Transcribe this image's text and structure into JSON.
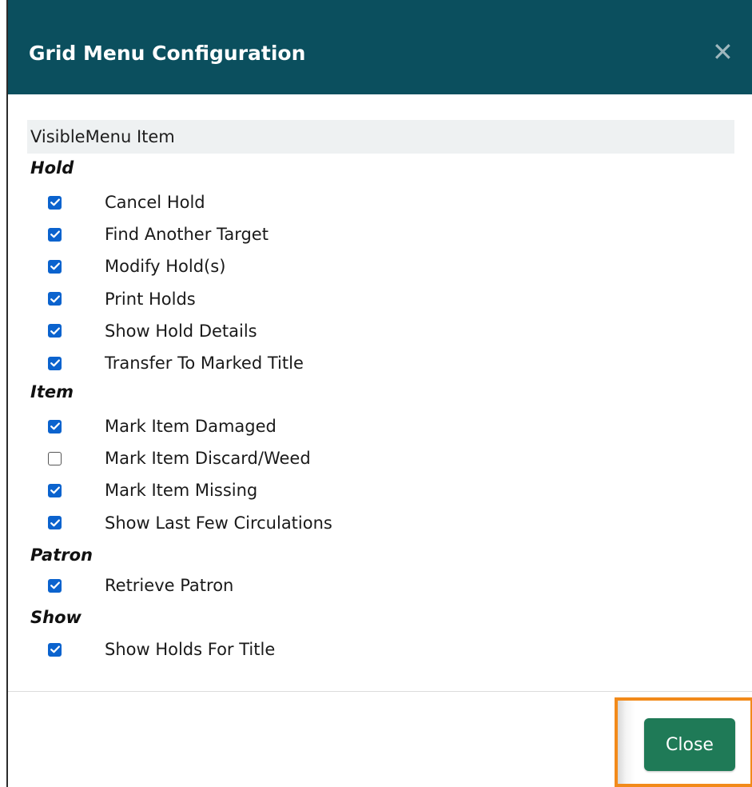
{
  "dialog": {
    "title": "Grid Menu Configuration",
    "close_icon": "close-icon",
    "close_glyph": "✕",
    "header_color": "#0b4f5e"
  },
  "grid": {
    "column_visible": "Visible",
    "column_menu_item": "Menu Item",
    "groups": [
      {
        "name": "Hold",
        "items": [
          {
            "label": "Cancel Hold",
            "visible": true
          },
          {
            "label": "Find Another Target",
            "visible": true
          },
          {
            "label": "Modify Hold(s)",
            "visible": true
          },
          {
            "label": "Print Holds",
            "visible": true
          },
          {
            "label": "Show Hold Details",
            "visible": true
          },
          {
            "label": "Transfer To Marked Title",
            "visible": true
          }
        ]
      },
      {
        "name": "Item",
        "items": [
          {
            "label": "Mark Item Damaged",
            "visible": true
          },
          {
            "label": "Mark Item Discard/Weed",
            "visible": false
          },
          {
            "label": "Mark Item Missing",
            "visible": true
          },
          {
            "label": "Show Last Few Circulations",
            "visible": true
          }
        ]
      },
      {
        "name": "Patron",
        "items": [
          {
            "label": "Retrieve Patron",
            "visible": true
          }
        ]
      },
      {
        "name": "Show",
        "items": [
          {
            "label": "Show Holds For Title",
            "visible": true
          }
        ]
      }
    ]
  },
  "footer": {
    "close_label": "Close",
    "close_button_color": "#1f7a57",
    "highlight_color": "#f28a1a"
  },
  "colors": {
    "checkbox_checked": "#0b63ce"
  }
}
